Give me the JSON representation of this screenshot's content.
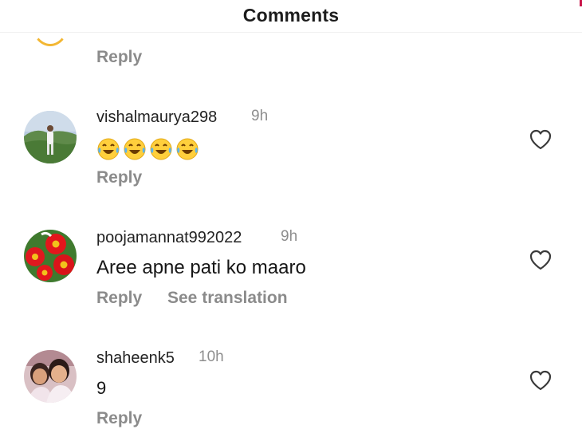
{
  "header": {
    "title": "Comments"
  },
  "top_partial": {
    "reply_label": "Reply"
  },
  "comments": [
    {
      "username": "vishalmaurya298",
      "time": "9h",
      "text": "😂😂😂😂",
      "reply_label": "Reply",
      "like_icon": "heart-outline-icon"
    },
    {
      "username": "poojamannat992022",
      "time": "9h",
      "text": "Aree apne pati ko maaro",
      "reply_label": "Reply",
      "translate_label": "See translation",
      "like_icon": "heart-outline-icon"
    },
    {
      "username": "shaheenk5",
      "time": "10h",
      "text": "9",
      "reply_label": "Reply",
      "like_icon": "heart-outline-icon"
    }
  ],
  "colors": {
    "secondary_text": "#8b8b8b",
    "primary_text": "#161616",
    "accent": "#c9154a"
  }
}
